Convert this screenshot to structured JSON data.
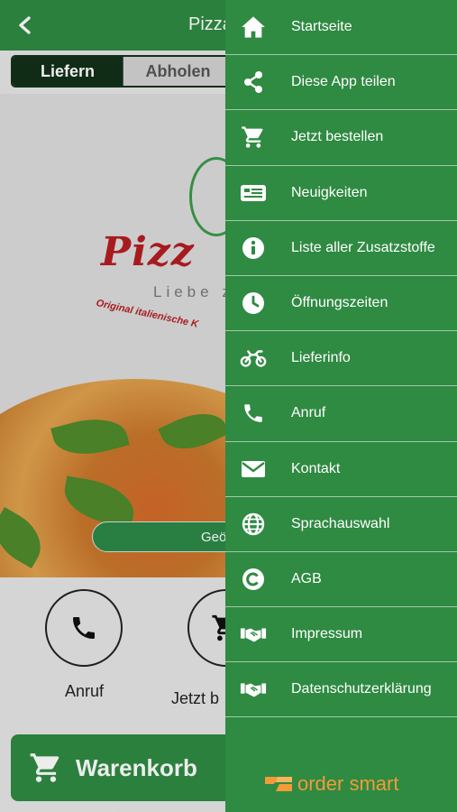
{
  "app": {
    "title": "Pizza",
    "tabs": {
      "deliver": "Liefern",
      "pickup": "Abholen"
    },
    "logo": {
      "name": "Pizz",
      "subtitle": "Liebe z",
      "tagline": "Original italienische K"
    },
    "location_button": "Geö",
    "actions": [
      {
        "label": "Anruf",
        "icon": "phone-icon"
      },
      {
        "label": "Jetzt b",
        "icon": "cart-icon"
      }
    ],
    "cart_label": "Warenkorb"
  },
  "drawer": {
    "items": [
      {
        "label": "Startseite",
        "icon": "home-icon"
      },
      {
        "label": "Diese App teilen",
        "icon": "share-icon"
      },
      {
        "label": "Jetzt bestellen",
        "icon": "cart-icon"
      },
      {
        "label": "Neuigkeiten",
        "icon": "news-icon"
      },
      {
        "label": "Liste aller Zusatzstoffe",
        "icon": "info-icon"
      },
      {
        "label": "Öffnungszeiten",
        "icon": "clock-icon"
      },
      {
        "label": "Lieferinfo",
        "icon": "motorbike-icon"
      },
      {
        "label": "Anruf",
        "icon": "phone-icon"
      },
      {
        "label": "Kontakt",
        "icon": "mail-icon"
      },
      {
        "label": "Sprachauswahl",
        "icon": "globe-icon"
      },
      {
        "label": "AGB",
        "icon": "copyright-icon"
      },
      {
        "label": "Impressum",
        "icon": "handshake-icon"
      },
      {
        "label": "Datenschutzerklärung",
        "icon": "handshake-icon"
      }
    ],
    "brand": "order smart"
  },
  "colors": {
    "primary_green": "#2f8a42",
    "dark_green": "#123018",
    "logo_red": "#b41e22",
    "brand_orange": "#f29b38"
  }
}
